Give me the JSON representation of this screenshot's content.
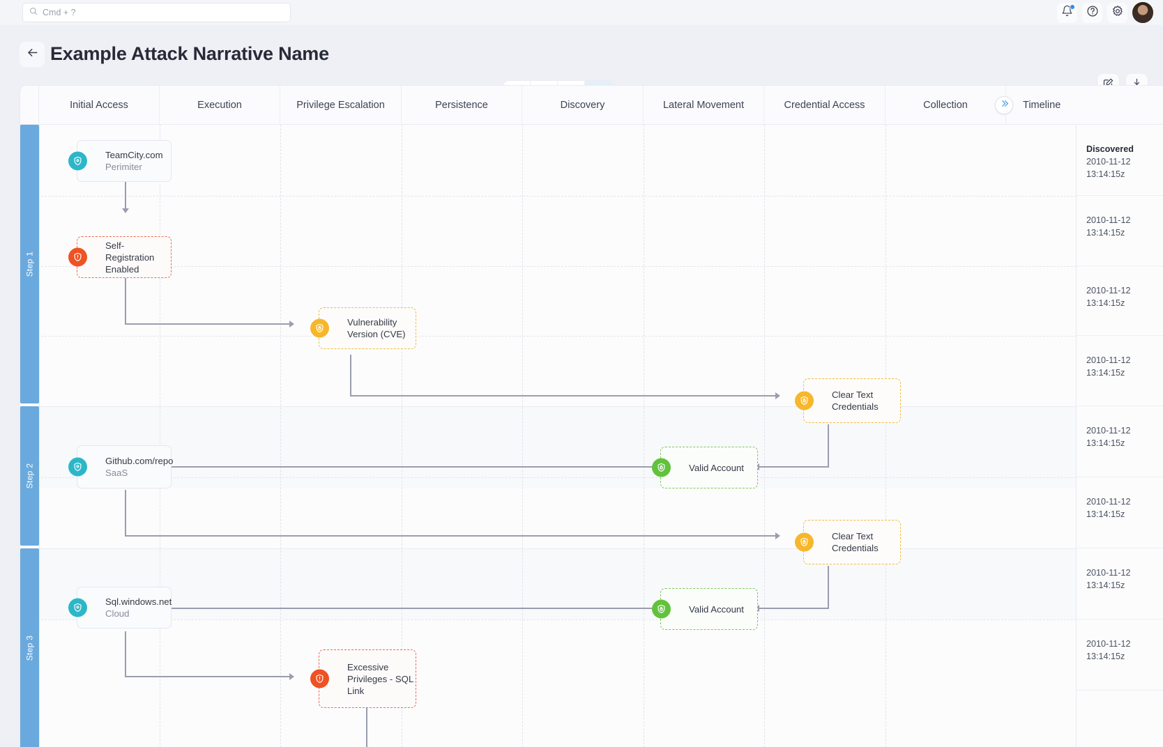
{
  "topbar": {
    "search": {
      "placeholder": "Cmd + ?",
      "value": ""
    },
    "icons": {
      "search": "search-icon",
      "notifications": "bell-icon",
      "help": "question-circle-icon",
      "settings": "gear-icon",
      "avatar": "user-avatar"
    }
  },
  "header": {
    "back": "back-arrow-icon",
    "title": "Example Attack Narrative Name",
    "view_buttons": [
      {
        "name": "columns-view",
        "icon": "columns-icon",
        "active": false
      },
      {
        "name": "tree-view",
        "icon": "hierarchy-icon",
        "active": false
      },
      {
        "name": "timeline-view",
        "icon": "clock-icon",
        "active": false
      },
      {
        "name": "attack-view",
        "icon": "shield-icon",
        "active": true
      }
    ],
    "actions": [
      {
        "name": "edit-button",
        "icon": "edit-square-icon"
      },
      {
        "name": "download-button",
        "icon": "download-icon"
      }
    ]
  },
  "board": {
    "columns": [
      "Initial Access",
      "Execution",
      "Privilege Escalation",
      "Persistence",
      "Discovery",
      "Lateral Movement",
      "Credential Access",
      "Collection"
    ],
    "timeline_header": "Timeline",
    "collapse_icon": "double-chevron-right-icon",
    "steps": [
      {
        "label": "Step 1"
      },
      {
        "label": "Step 2"
      },
      {
        "label": "Step 3"
      }
    ],
    "nodes": [
      {
        "id": "n1",
        "title": "TeamCity.com",
        "subtitle": "Perimiter",
        "kind": "asset",
        "badge": "shield-target-icon"
      },
      {
        "id": "n2",
        "title": "Self-Registration\nEnabled",
        "subtitle": "",
        "kind": "red",
        "badge": "shield-alert-icon"
      },
      {
        "id": "n3",
        "title": "Vulnerability\nVersion (CVE)",
        "subtitle": "",
        "kind": "amber",
        "badge": "shield-lock-icon"
      },
      {
        "id": "n4",
        "title": "Clear Text\nCredentials",
        "subtitle": "",
        "kind": "amber",
        "badge": "shield-lock-icon"
      },
      {
        "id": "n5",
        "title": "Github.com/repo",
        "subtitle": "SaaS",
        "kind": "asset",
        "badge": "shield-target-icon"
      },
      {
        "id": "n6",
        "title": "Valid Account",
        "subtitle": "",
        "kind": "green",
        "badge": "shield-check-icon"
      },
      {
        "id": "n7",
        "title": "Clear Text\nCredentials",
        "subtitle": "",
        "kind": "amber",
        "badge": "shield-lock-icon"
      },
      {
        "id": "n8",
        "title": "Sql.windows.net",
        "subtitle": "Cloud",
        "kind": "asset",
        "badge": "shield-target-icon"
      },
      {
        "id": "n9",
        "title": "Valid Account",
        "subtitle": "",
        "kind": "green",
        "badge": "shield-check-icon"
      },
      {
        "id": "n10",
        "title": "Excessive\nPrivileges - SQL\nLink",
        "subtitle": "",
        "kind": "red",
        "badge": "shield-alert-icon"
      }
    ],
    "timeline": [
      {
        "label": "Discovered",
        "date": "2010-11-12",
        "time": "13:14:15z"
      },
      {
        "label": "",
        "date": "2010-11-12",
        "time": "13:14:15z"
      },
      {
        "label": "",
        "date": "2010-11-12",
        "time": "13:14:15z"
      },
      {
        "label": "",
        "date": "2010-11-12",
        "time": "13:14:15z"
      },
      {
        "label": "",
        "date": "2010-11-12",
        "time": "13:14:15z"
      },
      {
        "label": "",
        "date": "2010-11-12",
        "time": "13:14:15z"
      },
      {
        "label": "",
        "date": "2010-11-12",
        "time": "13:14:15z"
      },
      {
        "label": "",
        "date": "2010-11-12",
        "time": "13:14:15z"
      }
    ]
  },
  "colors": {
    "accent": "#2f8ded",
    "step_rail": "#6aa9dd",
    "risk_high": "#ef5223",
    "risk_medium": "#f7b72b",
    "risk_ok": "#62c23c",
    "asset": "#2cb7c9"
  }
}
